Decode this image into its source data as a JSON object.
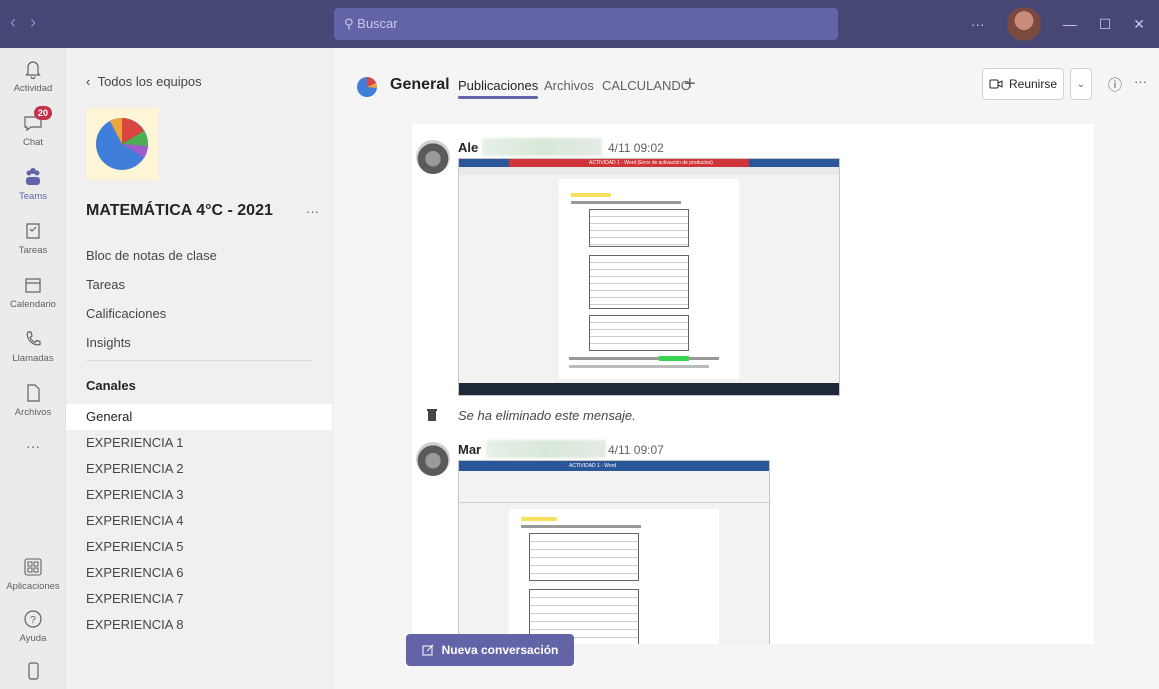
{
  "titlebar": {
    "search_placeholder": "Buscar",
    "back_icon": "chevron-left-icon",
    "forward_icon": "chevron-right-icon",
    "more_label": "···",
    "minimize_label": "—",
    "maximize_label": "☐",
    "close_label": "✕"
  },
  "appbar": {
    "items": [
      {
        "label": "Actividad",
        "icon": "bell-icon"
      },
      {
        "label": "Chat",
        "icon": "chat-icon",
        "badge": "20"
      },
      {
        "label": "Teams",
        "icon": "teams-icon"
      },
      {
        "label": "Tareas",
        "icon": "assignments-icon"
      },
      {
        "label": "Calendario",
        "icon": "calendar-icon"
      },
      {
        "label": "Llamadas",
        "icon": "phone-icon"
      },
      {
        "label": "Archivos",
        "icon": "file-icon"
      },
      {
        "label": "···",
        "icon": "more-icon"
      },
      {
        "label": "Aplicaciones",
        "icon": "apps-icon"
      },
      {
        "label": "Ayuda",
        "icon": "help-icon"
      }
    ]
  },
  "pane": {
    "back_label": "Todos los equipos",
    "team_name": "MATEMÁTICA 4°C - 2021",
    "team_more": "···",
    "tabs": [
      "Bloc de notas de clase",
      "Tareas",
      "Calificaciones",
      "Insights"
    ],
    "channels_heading": "Canales",
    "channels": [
      "General",
      "EXPERIENCIA 1",
      "EXPERIENCIA 2",
      "EXPERIENCIA 3",
      "EXPERIENCIA 4",
      "EXPERIENCIA 5",
      "EXPERIENCIA 6",
      "EXPERIENCIA 7",
      "EXPERIENCIA 8"
    ],
    "active_channel": "General"
  },
  "header": {
    "title": "General",
    "tabs": [
      "Publicaciones",
      "Archivos",
      "CALCULANDO"
    ],
    "active_tab": "Publicaciones",
    "add_tab": "+",
    "join_label": "Reunirse",
    "dropdown": "⌄",
    "info": "ⓘ",
    "more": "···"
  },
  "feed": {
    "posts": [
      {
        "author": "Ale",
        "time": "4/11 09:02",
        "attachment_title": "ACTIVIDAD 1 - Word (Error de activación de productos)"
      },
      {
        "deleted_text": "Se ha eliminado este mensaje."
      },
      {
        "author": "Mar",
        "time": "4/11 09:07",
        "attachment_title": "ACTIVIDAD 1 - Word"
      }
    ]
  },
  "compose": {
    "new_conversation_label": "Nueva conversación"
  },
  "colors": {
    "brand": "#6264a7",
    "titlebar": "#464775",
    "badge": "#c4314b"
  }
}
